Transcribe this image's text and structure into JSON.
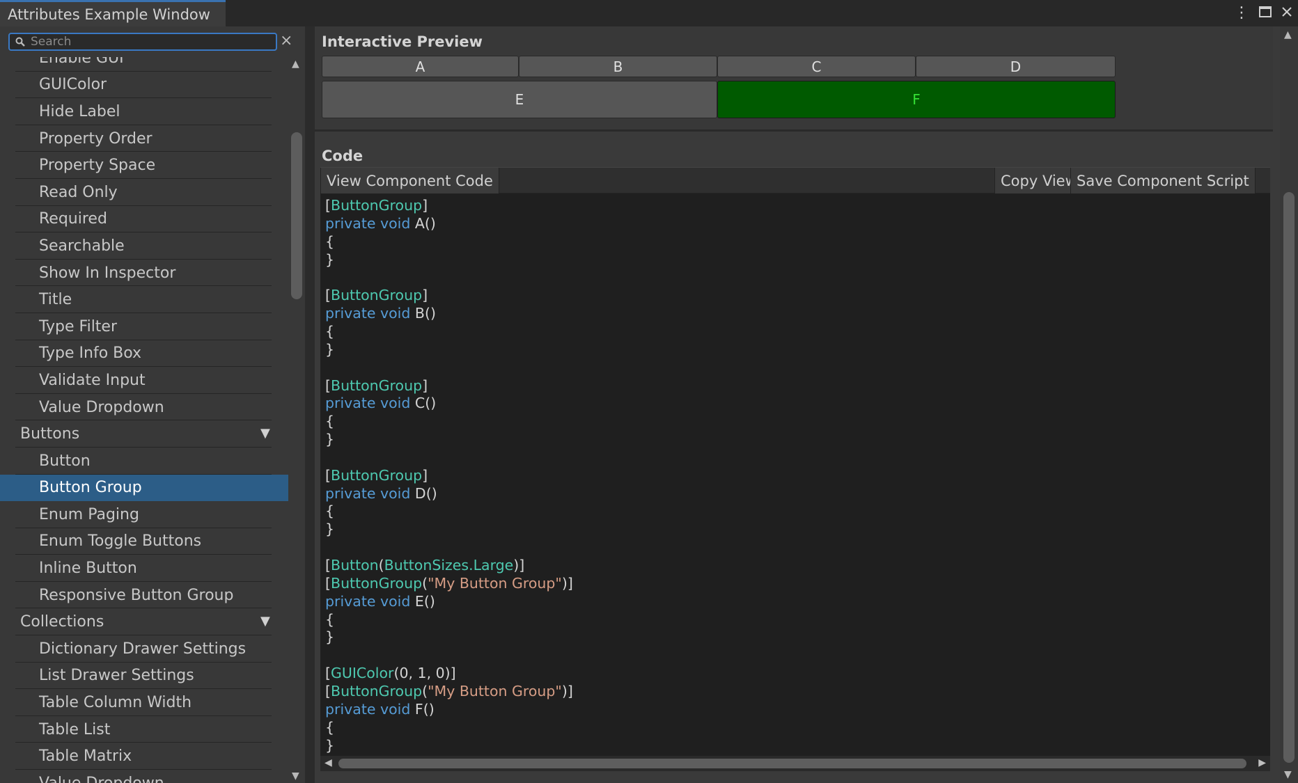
{
  "window": {
    "title": "Attributes Example Window",
    "menu_icon": "kebab-menu-icon",
    "maximize_icon": "maximize-icon",
    "close_icon": "close-icon"
  },
  "sidebar": {
    "search_placeholder": "Search",
    "clear_symbol": "×",
    "items": [
      {
        "label": "Enable GUI",
        "type": "child"
      },
      {
        "label": "GUIColor",
        "type": "child"
      },
      {
        "label": "Hide Label",
        "type": "child"
      },
      {
        "label": "Property Order",
        "type": "child"
      },
      {
        "label": "Property Space",
        "type": "child"
      },
      {
        "label": "Read Only",
        "type": "child"
      },
      {
        "label": "Required",
        "type": "child"
      },
      {
        "label": "Searchable",
        "type": "child"
      },
      {
        "label": "Show In Inspector",
        "type": "child"
      },
      {
        "label": "Title",
        "type": "child"
      },
      {
        "label": "Type Filter",
        "type": "child"
      },
      {
        "label": "Type Info Box",
        "type": "child"
      },
      {
        "label": "Validate Input",
        "type": "child"
      },
      {
        "label": "Value Dropdown",
        "type": "child"
      },
      {
        "label": "Buttons",
        "type": "category"
      },
      {
        "label": "Button",
        "type": "child"
      },
      {
        "label": "Button Group",
        "type": "child",
        "selected": true
      },
      {
        "label": "Enum Paging",
        "type": "child"
      },
      {
        "label": "Enum Toggle Buttons",
        "type": "child"
      },
      {
        "label": "Inline Button",
        "type": "child"
      },
      {
        "label": "Responsive Button Group",
        "type": "child"
      },
      {
        "label": "Collections",
        "type": "category"
      },
      {
        "label": "Dictionary Drawer Settings",
        "type": "child"
      },
      {
        "label": "List Drawer Settings",
        "type": "child"
      },
      {
        "label": "Table Column Width",
        "type": "child"
      },
      {
        "label": "Table List",
        "type": "child"
      },
      {
        "label": "Table Matrix",
        "type": "child"
      },
      {
        "label": "Value Dropdown",
        "type": "child"
      }
    ]
  },
  "preview": {
    "title": "Interactive Preview",
    "buttons_row1": [
      "A",
      "B",
      "C",
      "D"
    ],
    "button_e": "E",
    "button_f": "F",
    "button_f_color": "#005a00",
    "button_f_text_color": "#35e035"
  },
  "code": {
    "title": "Code",
    "view_component_code": "View Component Code",
    "copy_view": "Copy View",
    "save_component_script": "Save Component Script",
    "lines": [
      [
        [
          "p",
          "["
        ],
        [
          "a",
          "ButtonGroup"
        ],
        [
          "p",
          "]"
        ]
      ],
      [
        [
          "k",
          "private void"
        ],
        [
          "p",
          " A()"
        ]
      ],
      [
        [
          "p",
          "{"
        ]
      ],
      [
        [
          "p",
          "}"
        ]
      ],
      [],
      [
        [
          "p",
          "["
        ],
        [
          "a",
          "ButtonGroup"
        ],
        [
          "p",
          "]"
        ]
      ],
      [
        [
          "k",
          "private void"
        ],
        [
          "p",
          " B()"
        ]
      ],
      [
        [
          "p",
          "{"
        ]
      ],
      [
        [
          "p",
          "}"
        ]
      ],
      [],
      [
        [
          "p",
          "["
        ],
        [
          "a",
          "ButtonGroup"
        ],
        [
          "p",
          "]"
        ]
      ],
      [
        [
          "k",
          "private void"
        ],
        [
          "p",
          " C()"
        ]
      ],
      [
        [
          "p",
          "{"
        ]
      ],
      [
        [
          "p",
          "}"
        ]
      ],
      [],
      [
        [
          "p",
          "["
        ],
        [
          "a",
          "ButtonGroup"
        ],
        [
          "p",
          "]"
        ]
      ],
      [
        [
          "k",
          "private void"
        ],
        [
          "p",
          " D()"
        ]
      ],
      [
        [
          "p",
          "{"
        ]
      ],
      [
        [
          "p",
          "}"
        ]
      ],
      [],
      [
        [
          "p",
          "["
        ],
        [
          "a",
          "Button"
        ],
        [
          "p",
          "("
        ],
        [
          "a",
          "ButtonSizes.Large"
        ],
        [
          "p",
          ")]"
        ]
      ],
      [
        [
          "p",
          "["
        ],
        [
          "a",
          "ButtonGroup"
        ],
        [
          "p",
          "("
        ],
        [
          "s",
          "\"My Button Group\""
        ],
        [
          "p",
          ")]"
        ]
      ],
      [
        [
          "k",
          "private void"
        ],
        [
          "p",
          " E()"
        ]
      ],
      [
        [
          "p",
          "{"
        ]
      ],
      [
        [
          "p",
          "}"
        ]
      ],
      [],
      [
        [
          "p",
          "["
        ],
        [
          "a",
          "GUIColor"
        ],
        [
          "p",
          "(0, 1, 0)]"
        ]
      ],
      [
        [
          "p",
          "["
        ],
        [
          "a",
          "ButtonGroup"
        ],
        [
          "p",
          "("
        ],
        [
          "s",
          "\"My Button Group\""
        ],
        [
          "p",
          ")]"
        ]
      ],
      [
        [
          "k",
          "private void"
        ],
        [
          "p",
          " F()"
        ]
      ],
      [
        [
          "p",
          "{"
        ]
      ],
      [
        [
          "p",
          "}"
        ]
      ]
    ]
  }
}
